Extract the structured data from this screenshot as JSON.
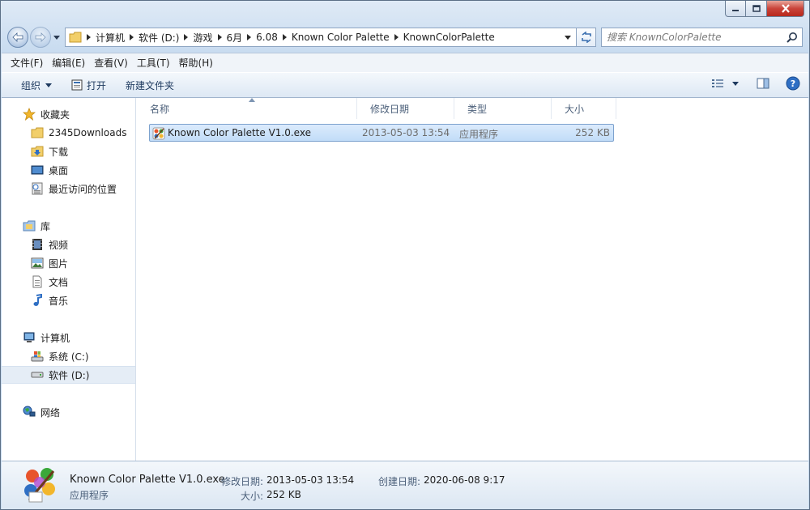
{
  "window": {
    "controls": {
      "minimize": "minimize",
      "maximize": "maximize",
      "close": "close"
    }
  },
  "address": {
    "crumbs": [
      "计算机",
      "软件 (D:)",
      "游戏",
      "6月",
      "6.08",
      "Known Color Palette",
      "KnownColorPalette"
    ]
  },
  "search": {
    "placeholder": "搜索 KnownColorPalette"
  },
  "menu": [
    "文件(F)",
    "编辑(E)",
    "查看(V)",
    "工具(T)",
    "帮助(H)"
  ],
  "toolbar": {
    "organize": "组织",
    "open": "打开",
    "new_folder": "新建文件夹"
  },
  "nav": {
    "favorites": {
      "label": "收藏夹",
      "items": [
        "2345Downloads",
        "下载",
        "桌面",
        "最近访问的位置"
      ]
    },
    "libraries": {
      "label": "库",
      "items": [
        "视频",
        "图片",
        "文档",
        "音乐"
      ]
    },
    "computer": {
      "label": "计算机",
      "items": [
        "系统 (C:)",
        "软件 (D:)"
      ]
    },
    "network": {
      "label": "网络"
    },
    "selected": "软件 (D:)"
  },
  "columns": [
    "名称",
    "修改日期",
    "类型",
    "大小"
  ],
  "files": [
    {
      "name": "Known Color Palette V1.0.exe",
      "modified": "2013-05-03 13:54",
      "type": "应用程序",
      "size": "252 KB"
    }
  ],
  "details": {
    "name": "Known Color Palette V1.0.exe",
    "type": "应用程序",
    "modified_label": "修改日期:",
    "modified": "2013-05-03 13:54",
    "size_label": "大小:",
    "size": "252 KB",
    "created_label": "创建日期:",
    "created": "2020-06-08 9:17"
  },
  "colors": {
    "accent": "#1e3a5f",
    "selection": "#c1dcf8"
  }
}
